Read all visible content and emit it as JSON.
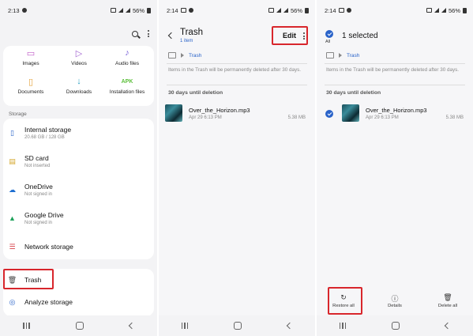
{
  "panel1": {
    "status": {
      "time": "2:13",
      "battery": "56%"
    },
    "categories": [
      {
        "label": "Images",
        "icon": "image-icon"
      },
      {
        "label": "Videos",
        "icon": "video-icon"
      },
      {
        "label": "Audio files",
        "icon": "music-note-icon"
      },
      {
        "label": "Documents",
        "icon": "document-icon"
      },
      {
        "label": "Downloads",
        "icon": "download-icon"
      },
      {
        "label": "Installation files",
        "icon": "apk-icon",
        "glyph": "APK"
      }
    ],
    "storage_header": "Storage",
    "storage": [
      {
        "title": "Internal storage",
        "sub": "20.68 GB / 128 GB",
        "icon": "phone-icon"
      },
      {
        "title": "SD card",
        "sub": "Not inserted",
        "icon": "sd-card-icon"
      },
      {
        "title": "OneDrive",
        "sub": "Not signed in",
        "icon": "onedrive-icon"
      },
      {
        "title": "Google Drive",
        "sub": "Not signed in",
        "icon": "google-drive-icon"
      },
      {
        "title": "Network storage",
        "sub": "",
        "icon": "network-storage-icon"
      }
    ],
    "trash_label": "Trash",
    "analyze_label": "Analyze storage"
  },
  "panel2": {
    "status": {
      "time": "2:14",
      "battery": "56%"
    },
    "title": "Trash",
    "subtitle": "1 item",
    "edit_label": "Edit",
    "breadcrumb": "Trash",
    "info": "Items in the Trash will be permanently deleted after 30 days.",
    "section": "30 days until deletion",
    "file": {
      "name": "Over_the_Horizon.mp3",
      "date": "Apr 29 6:13 PM",
      "size": "5.38 MB"
    }
  },
  "panel3": {
    "status": {
      "time": "2:14",
      "battery": "56%"
    },
    "all_label": "All",
    "selected_title": "1 selected",
    "breadcrumb": "Trash",
    "info": "Items in the Trash will be permanently deleted after 30 days.",
    "section": "30 days until deletion",
    "file": {
      "name": "Over_the_Horizon.mp3",
      "date": "Apr 29 6:13 PM",
      "size": "5.38 MB"
    },
    "actions": {
      "restore": "Restore all",
      "details": "Details",
      "delete": "Delete all"
    }
  },
  "colors": {
    "accent": "#2a63c9",
    "highlight": "#d8262c"
  }
}
